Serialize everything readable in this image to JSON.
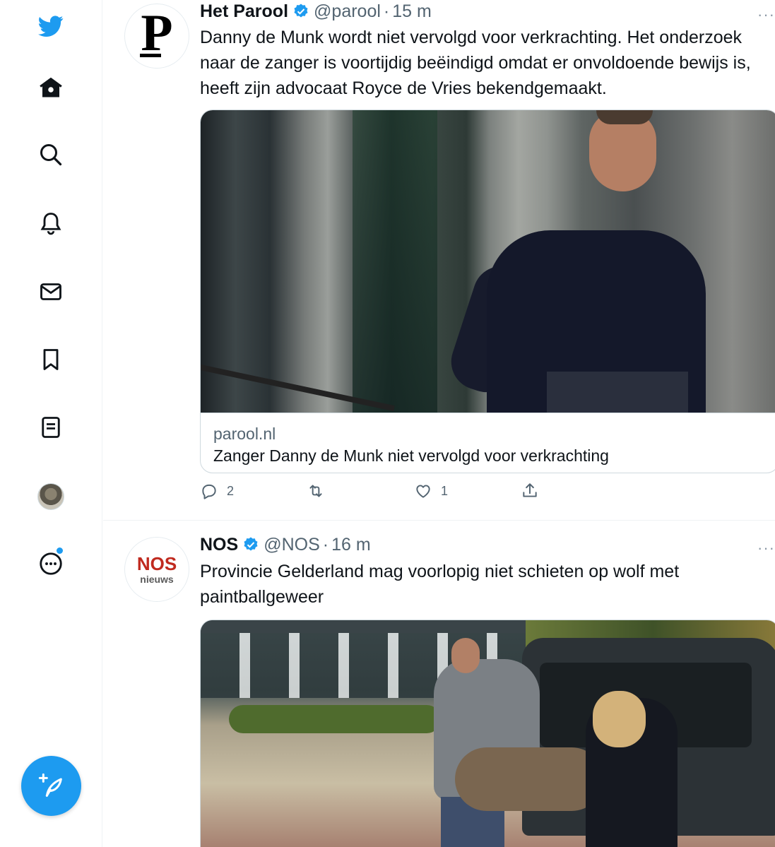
{
  "sidebar": {
    "icons": [
      "twitter-logo-icon",
      "home-icon",
      "search-icon",
      "notifications-icon",
      "messages-icon",
      "bookmarks-icon",
      "lists-icon",
      "profile-avatar",
      "more-icon"
    ],
    "compose_icon": "compose-tweet-icon"
  },
  "colors": {
    "accent": "#1d9bf0",
    "text": "#0f1419",
    "secondary": "#536471",
    "border": "#cfd9de",
    "nos_red": "#c02a1f"
  },
  "tweets": [
    {
      "author": "Het Parool",
      "handle": "@parool",
      "separator": "·",
      "time": "15 m",
      "avatar_letter": "P",
      "text": "Danny de Munk wordt niet vervolgd voor verkrachting. Het onderzoek naar de zanger is voortijdig beëindigd omdat er onvoldoende bewijs is, heeft zijn advocaat Royce de Vries bekendgemaakt.",
      "card": {
        "domain": "parool.nl",
        "title": "Zanger Danny de Munk niet vervolgd voor verkrachting"
      },
      "stats": {
        "replies": "2",
        "retweets": "",
        "likes": "1"
      }
    },
    {
      "author": "NOS",
      "handle": "@NOS",
      "separator": "·",
      "time": "16 m",
      "avatar_brand": "NOS",
      "avatar_sub": "nieuws",
      "text": "Provincie Gelderland mag voorlopig niet schieten op wolf met paintballgeweer"
    }
  ],
  "more_label": "···"
}
